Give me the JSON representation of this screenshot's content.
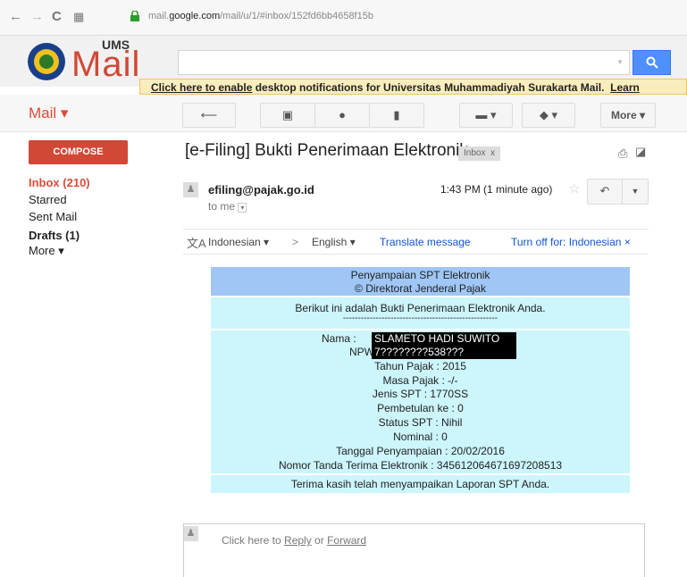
{
  "browser": {
    "url_prefix": "mail.",
    "url_domain": "google.com",
    "url_path": "/mail/u/1/#inbox/152fd6bb4658f15b"
  },
  "logo": {
    "top": "UMS",
    "main": "Mail"
  },
  "notification": {
    "link": "Click here to enable",
    "text": " desktop notifications for Universitas Muhammadiyah Surakarta Mail.",
    "learn": "Learn"
  },
  "toolbar": {
    "mail_label": "Mail ▾",
    "more": "More ▾"
  },
  "sidebar": {
    "compose": "COMPOSE",
    "inbox": "Inbox (210)",
    "starred": "Starred",
    "sent": "Sent Mail",
    "drafts": "Drafts (1)",
    "more": "More ▾"
  },
  "email": {
    "subject": "[e-Filing] Bukti Penerimaan Elektronik",
    "label": "Inbox",
    "label_x": "x",
    "sender": "efiling@pajak.go.id",
    "to": "to me",
    "time": "1:43 PM (1 minute ago)"
  },
  "translate": {
    "from": "Indonesian ▾",
    "arrow": ">",
    "to": "English ▾",
    "action": "Translate message",
    "turnoff": "Turn off for: Indonesian ×"
  },
  "receipt": {
    "title1": "Penyampaian SPT Elektronik",
    "title2": "© Direktorat Jenderal Pajak",
    "intro": "Berikut ini adalah Bukti Penerimaan Elektronik Anda.",
    "dashes": "----------------------------------------------------",
    "nama": "Nama :",
    "nama_val": "SLAMETO HADI SUWITO",
    "npwp": "NPWP :",
    "npwp_val": "7????????538???",
    "tahun": "Tahun Pajak : 2015",
    "masa": "Masa Pajak : -/-",
    "jenis": "Jenis SPT : 1770SS",
    "pembetulan": "Pembetulan ke : 0",
    "status": "Status SPT : Nihil",
    "nominal": "Nominal : 0",
    "tanggal": "Tanggal Penyampaian : 20/02/2016",
    "nomor": "Nomor Tanda Terima Elektronik : 345612064671697208513",
    "thanks": "Terima kasih telah menyampaikan Laporan SPT Anda."
  },
  "reply": {
    "pre": "Click here to ",
    "reply": "Reply",
    "or": " or ",
    "forward": "Forward"
  }
}
